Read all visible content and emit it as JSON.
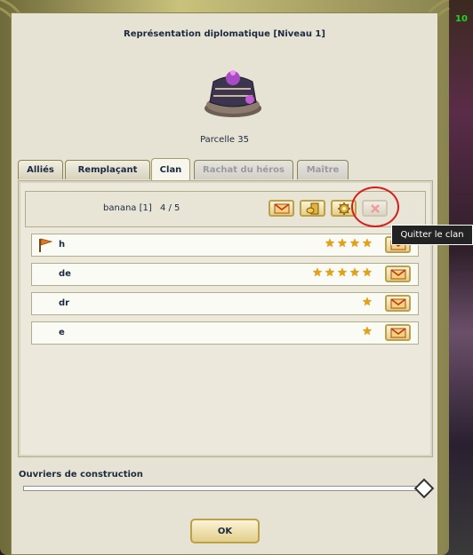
{
  "window": {
    "title": "Représentation diplomatique [Niveau 1]",
    "subtitle": "Parcelle 35"
  },
  "tabs": [
    {
      "label": "Alliés",
      "state": "normal"
    },
    {
      "label": "Remplaçant",
      "state": "normal"
    },
    {
      "label": "Clan",
      "state": "active"
    },
    {
      "label": "Rachat du héros",
      "state": "disabled"
    },
    {
      "label": "Maître",
      "state": "disabled"
    }
  ],
  "clan": {
    "name": "banana [1]",
    "count": "4 / 5",
    "buttons": [
      {
        "icon": "envelope-icon"
      },
      {
        "icon": "coins-icon"
      },
      {
        "icon": "gear-icon"
      },
      {
        "icon": "close-icon",
        "state": "disabled"
      }
    ]
  },
  "tooltip": "Quitter le clan",
  "members": [
    {
      "name": "h",
      "stars": 4,
      "leader": true
    },
    {
      "name": "de",
      "stars": 5,
      "leader": false
    },
    {
      "name": "dr",
      "stars": 1,
      "leader": false
    },
    {
      "name": "e",
      "stars": 1,
      "leader": false
    }
  ],
  "slider": {
    "label": "Ouvriers de construction",
    "value": 1.0
  },
  "ok_label": "OK",
  "colors": {
    "accent": "#d61c1c",
    "gold": "#bda14a",
    "panel": "#ece9dc",
    "text": "#1c2a40"
  },
  "corner_number": "10"
}
